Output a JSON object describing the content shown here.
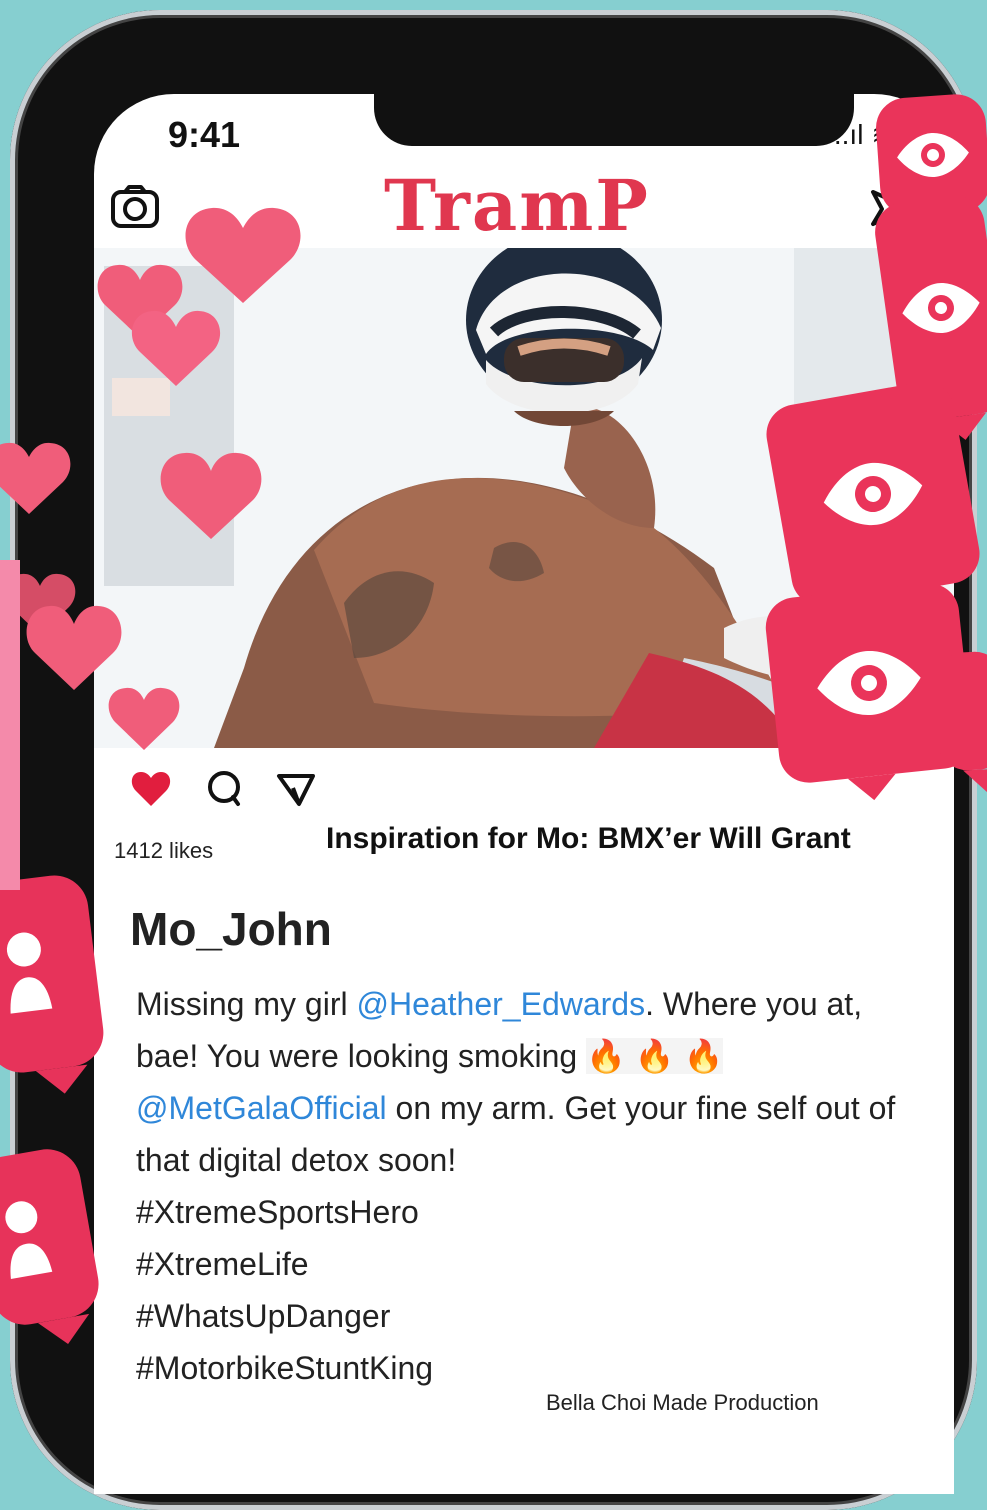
{
  "statusBar": {
    "time": "9:41",
    "indicators": "..ıl ≋ ▰"
  },
  "app": {
    "brand": "TramP"
  },
  "post": {
    "likes": "1412 likes",
    "captionTitle": "Inspiration for Mo: BMX’er Will Grant",
    "username": "Mo_John",
    "textParts": [
      "Missing my girl ",
      "@Heather_Edwards",
      ". Where you at, bae! You were looking smoking ",
      " 🔥 🔥 🔥 ",
      "@MetGalaOfficial",
      " on my arm. Get your fine self out of that digital detox soon!"
    ],
    "hashtags": [
      "#XtremeSportsHero",
      "#XtremeLife",
      "#WhatsUpDanger",
      "#MotorbikeStuntKing"
    ]
  },
  "footer": {
    "credit": "Bella Choi Made Production"
  },
  "colors": {
    "background": "#86cfd0",
    "accent": "#e0374f",
    "heart": "#f05d7a",
    "sticker": "#ea345a",
    "mention": "#2f87d9"
  },
  "icons": {
    "camera": "camera-icon",
    "send": "send-icon",
    "like": "heart-icon",
    "comment": "comment-icon",
    "share": "share-icon",
    "eye": "eye-icon",
    "person": "person-icon"
  }
}
